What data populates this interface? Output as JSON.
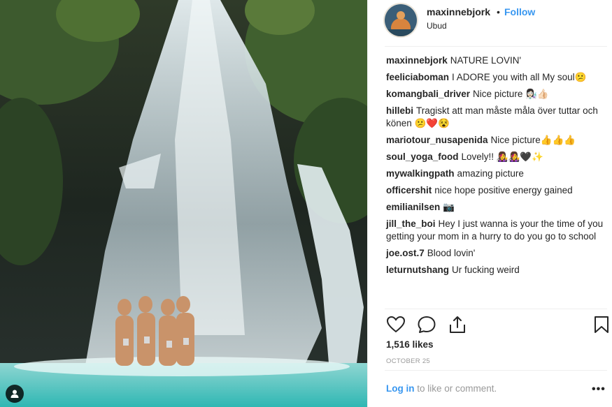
{
  "header": {
    "username": "maxinnebjork",
    "separator": "•",
    "follow_label": "Follow",
    "location": "Ubud"
  },
  "comments": [
    {
      "user": "maxinnebjork",
      "text": "NATURE LOVIN'"
    },
    {
      "user": "feeliciaboman",
      "text": "I ADORE you with all My soul😕"
    },
    {
      "user": "komangbali_driver",
      "text": "Nice picture 👩🏻‍🔬👍🏻"
    },
    {
      "user": "hillebi",
      "text": "Tragiskt att man måste måla över tuttar och könen 😕❤️😵"
    },
    {
      "user": "mariotour_nusapenida",
      "text": "Nice picture👍👍👍"
    },
    {
      "user": "soul_yoga_food",
      "text": "Lovely!! 👩‍🎤👩‍🎤🖤✨"
    },
    {
      "user": "mywalkingpath",
      "text": "amazing picture"
    },
    {
      "user": "officershit",
      "text": "nice hope positive energy gained"
    },
    {
      "user": "emilianilsen",
      "text": "📷"
    },
    {
      "user": "jill_the_boi",
      "text": "Hey I just wanna is your the time of you getting your mom in a hurry to do you go to school"
    },
    {
      "user": "joe.ost.7",
      "text": "Blood lovin'"
    },
    {
      "user": "leturnutshang",
      "text": "Ur fucking weird"
    }
  ],
  "actions": {
    "icons": [
      "heart-icon",
      "comment-icon",
      "share-icon",
      "bookmark-icon"
    ]
  },
  "likes": "1,516 likes",
  "date": "OCTOBER 25",
  "footer": {
    "login_link": "Log in",
    "login_rest": " to like or comment.",
    "more": "•••"
  },
  "photo": {
    "tag_icon": "user-tag-icon"
  }
}
